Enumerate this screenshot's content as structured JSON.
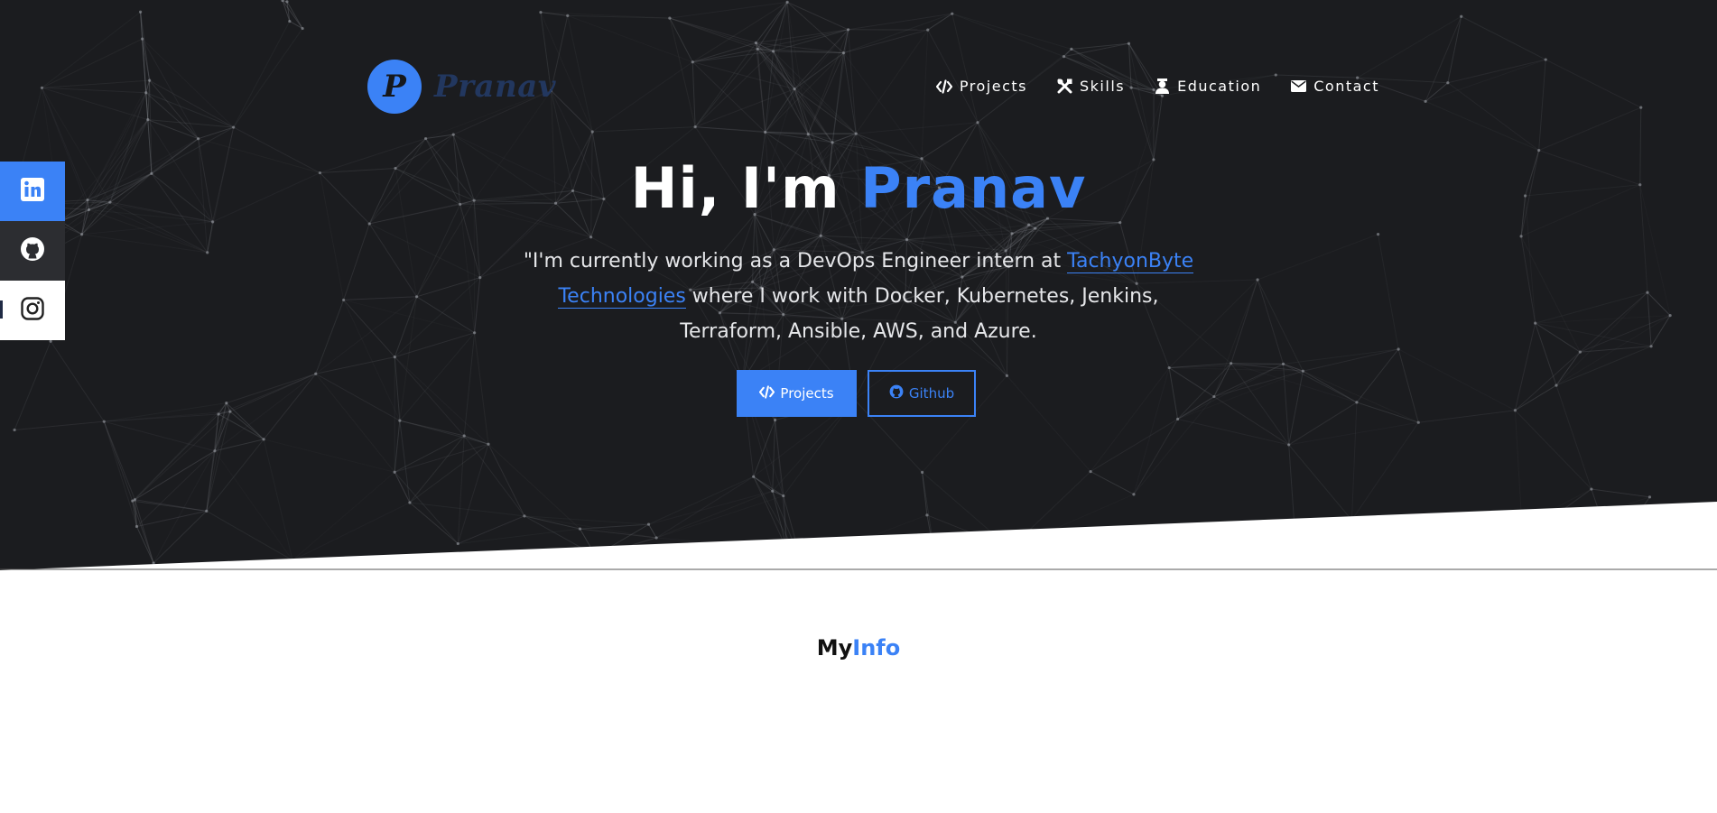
{
  "brand": {
    "logo_letter": "P",
    "name": "Pranav"
  },
  "nav": {
    "items": [
      {
        "label": "Projects",
        "icon": "code-icon"
      },
      {
        "label": "Skills",
        "icon": "tools-icon"
      },
      {
        "label": "Education",
        "icon": "graduate-icon"
      },
      {
        "label": "Contact",
        "icon": "envelope-icon"
      }
    ]
  },
  "social": {
    "items": [
      {
        "icon": "linkedin-icon"
      },
      {
        "icon": "github-icon"
      },
      {
        "icon": "instagram-icon"
      }
    ]
  },
  "hero": {
    "greeting": "Hi, I'm ",
    "name": "Pranav",
    "intro_before": "\"I'm currently working as a DevOps Engineer intern at ",
    "company_link": "TachyonByte Technologies",
    "intro_after": " where I work with Docker, Kubernetes, Jenkins, Terraform, Ansible, AWS, and Azure.",
    "buttons": {
      "projects_label": "Projects",
      "github_label": "Github"
    }
  },
  "info_section": {
    "title_prefix": "My",
    "title_accent": "Info"
  },
  "colors": {
    "accent": "#3b82f6",
    "hero_background": "#1b1c1f",
    "github_button_bg": "#2c2d31"
  }
}
